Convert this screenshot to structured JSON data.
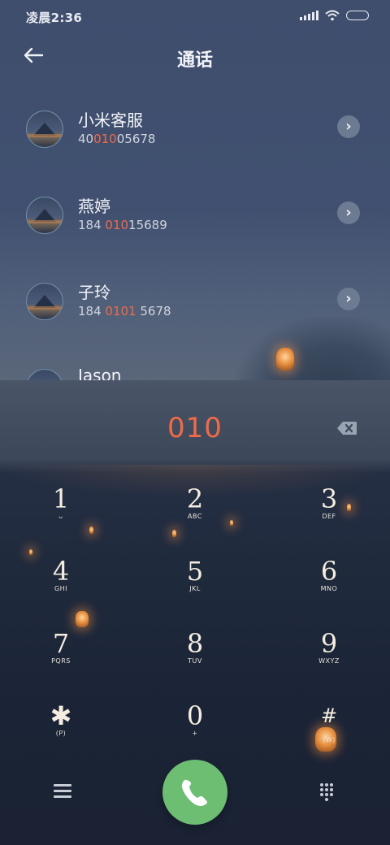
{
  "status_bar": {
    "time": "凌晨2:36"
  },
  "header": {
    "title": "通话"
  },
  "contacts": [
    {
      "name": "小米客服",
      "number_pre": "40",
      "number_match": "010",
      "number_post": "05678"
    },
    {
      "name": "燕婷",
      "number_pre": "184 ",
      "number_match": "010",
      "number_post": "15689"
    },
    {
      "name": "子玲",
      "number_pre": "184 ",
      "number_match": "0101",
      "number_post": " 5678"
    },
    {
      "name": "Jason",
      "number_pre": "",
      "number_match": "",
      "number_post": ""
    }
  ],
  "dialer": {
    "typed_number": "010",
    "keys": [
      {
        "digit": "1",
        "letters": "ᴗ"
      },
      {
        "digit": "2",
        "letters": "ABC"
      },
      {
        "digit": "3",
        "letters": "DEF"
      },
      {
        "digit": "4",
        "letters": "GHI"
      },
      {
        "digit": "5",
        "letters": "JKL"
      },
      {
        "digit": "6",
        "letters": "MNO"
      },
      {
        "digit": "7",
        "letters": "PQRS"
      },
      {
        "digit": "8",
        "letters": "TUV"
      },
      {
        "digit": "9",
        "letters": "WXYZ"
      },
      {
        "digit": "✱",
        "letters": "(P)"
      },
      {
        "digit": "0",
        "letters": "+"
      },
      {
        "digit": "#",
        "letters": "(W)"
      }
    ]
  },
  "icons": {
    "back": "back-arrow-icon",
    "chevron": "chevron-right-icon",
    "backspace": "backspace-icon",
    "call": "phone-icon",
    "menu": "menu-icon",
    "keypad": "keypad-icon"
  },
  "colors": {
    "highlight": "#f26a45",
    "call_button": "#6dbd73"
  }
}
